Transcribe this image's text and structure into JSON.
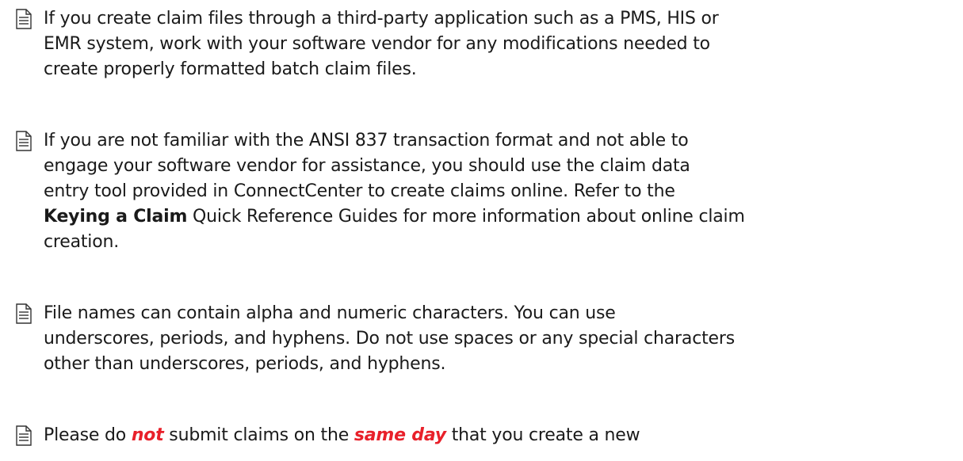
{
  "icon": "document-note-icon",
  "accent_color": "#e8202a",
  "bullets": [
    {
      "lines": [
        [
          "If you create claim files through a third-party application such as a PMS, HIS  or"
        ],
        [
          "EMR system, work with your software vendor for any modifications needed to"
        ],
        [
          "create properly formatted batch claim files."
        ]
      ]
    },
    {
      "lines": [
        [
          "If you are not familiar with the ANSI 837 transaction format and not able to"
        ],
        [
          "engage your software vendor  for assistance, you should use the claim data"
        ],
        [
          "entry tool provided in ConnectCenter to create claims online.   Refer to the"
        ],
        [
          "",
          "Keying a Claim",
          " Quick Reference Guides for more information about online claim"
        ],
        [
          "creation."
        ]
      ]
    },
    {
      "lines": [
        [
          "File names can contain alpha and numeric characters. You can use"
        ],
        [
          "underscores, periods, and hyphens. Do not use spaces or any special characters"
        ],
        [
          "other than underscores, periods, and hyphens."
        ]
      ]
    },
    {
      "lines": [
        [
          "Please do ",
          "not",
          " submit claims on the ",
          "same day",
          " that you create a new"
        ]
      ]
    }
  ]
}
